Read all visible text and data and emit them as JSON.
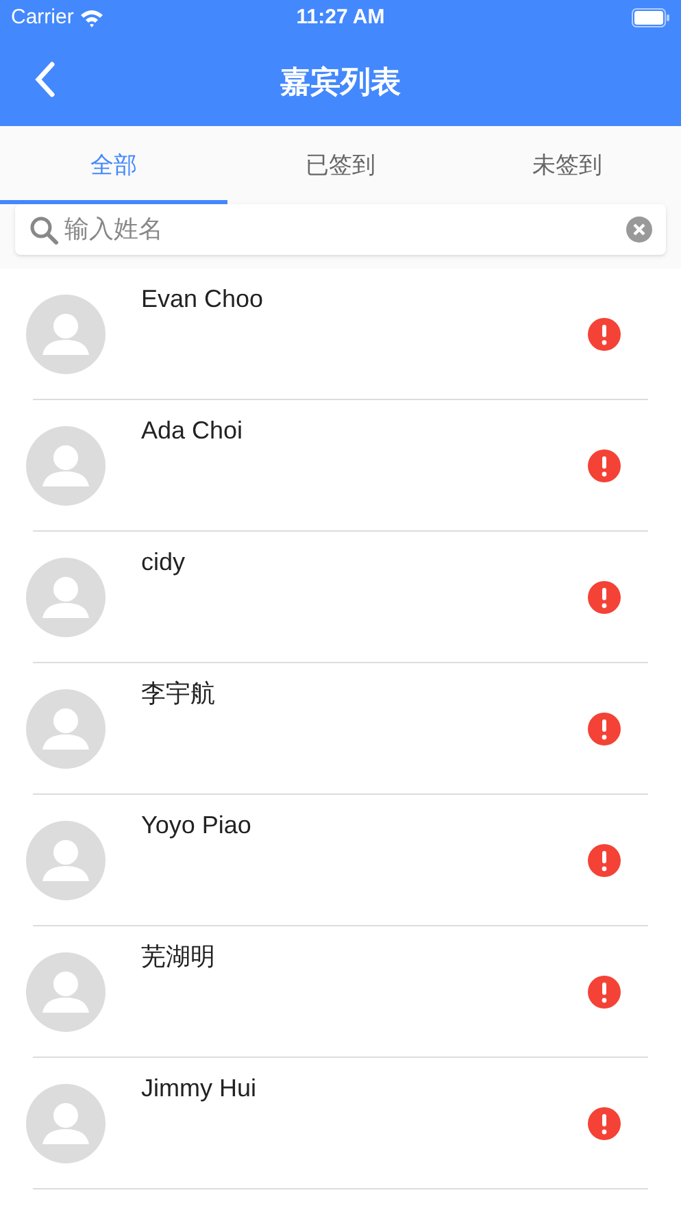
{
  "status_bar": {
    "carrier": "Carrier",
    "time": "11:27 AM"
  },
  "nav": {
    "title": "嘉宾列表"
  },
  "tabs": [
    {
      "label": "全部",
      "selected": true
    },
    {
      "label": "已签到",
      "selected": false
    },
    {
      "label": "未签到",
      "selected": false
    }
  ],
  "search": {
    "placeholder": "输入姓名"
  },
  "guests": [
    {
      "name": "Evan Choo",
      "checked_in": false
    },
    {
      "name": "Ada Choi",
      "checked_in": false
    },
    {
      "name": "cidy",
      "checked_in": false
    },
    {
      "name": "李宇航",
      "checked_in": false
    },
    {
      "name": "Yoyo Piao",
      "checked_in": false
    },
    {
      "name": "芜湖明",
      "checked_in": false
    },
    {
      "name": "Jimmy Hui",
      "checked_in": false
    }
  ]
}
